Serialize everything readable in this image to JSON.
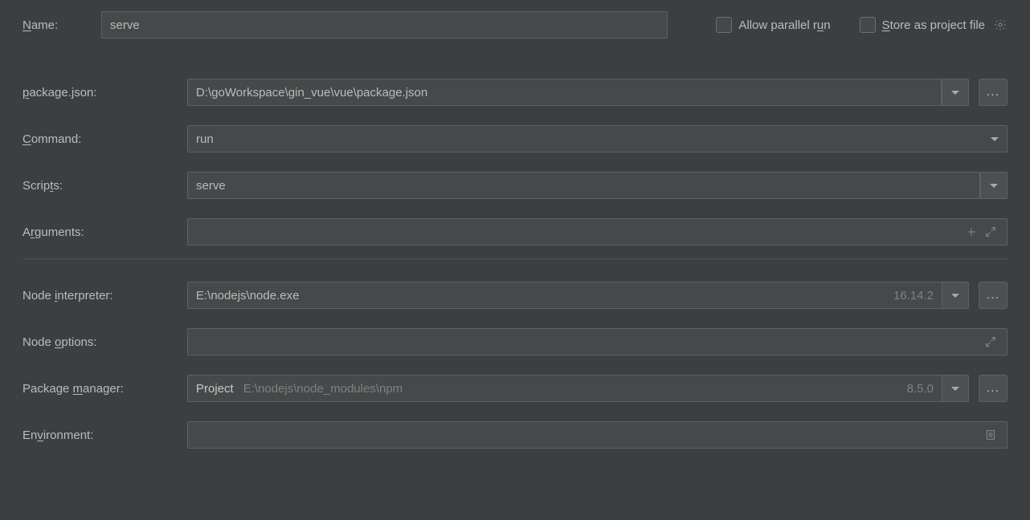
{
  "name": {
    "label_pre": "N",
    "label_u": "",
    "label_post": "ame:",
    "value": "serve"
  },
  "allow_parallel": {
    "pre": "Allow parallel r",
    "u": "u",
    "post": "n"
  },
  "store_project": {
    "pre": "",
    "u": "S",
    "post": "tore as project file"
  },
  "package_json": {
    "u": "p",
    "post": "ackage.json:",
    "value": "D:\\goWorkspace\\gin_vue\\vue\\package.json"
  },
  "command": {
    "u": "C",
    "post": "ommand:",
    "value": "run"
  },
  "scripts": {
    "pre": "Scrip",
    "u": "t",
    "post": "s:",
    "value": "serve"
  },
  "arguments": {
    "pre": "A",
    "u": "r",
    "post": "guments:",
    "value": ""
  },
  "node_interpreter": {
    "pre": "Node ",
    "u": "i",
    "post": "nterpreter:",
    "value": "E:\\nodejs\\node.exe",
    "version": "16.14.2"
  },
  "node_options": {
    "pre": "Node ",
    "u": "o",
    "post": "ptions:",
    "value": ""
  },
  "package_manager": {
    "pre": "Package ",
    "u": "m",
    "post": "anager:",
    "prefix": "Project",
    "value": "E:\\nodejs\\node_modules\\npm",
    "version": "8.5.0"
  },
  "environment": {
    "pre": "En",
    "u": "v",
    "post": "ironment:",
    "value": ""
  },
  "browse": "..."
}
